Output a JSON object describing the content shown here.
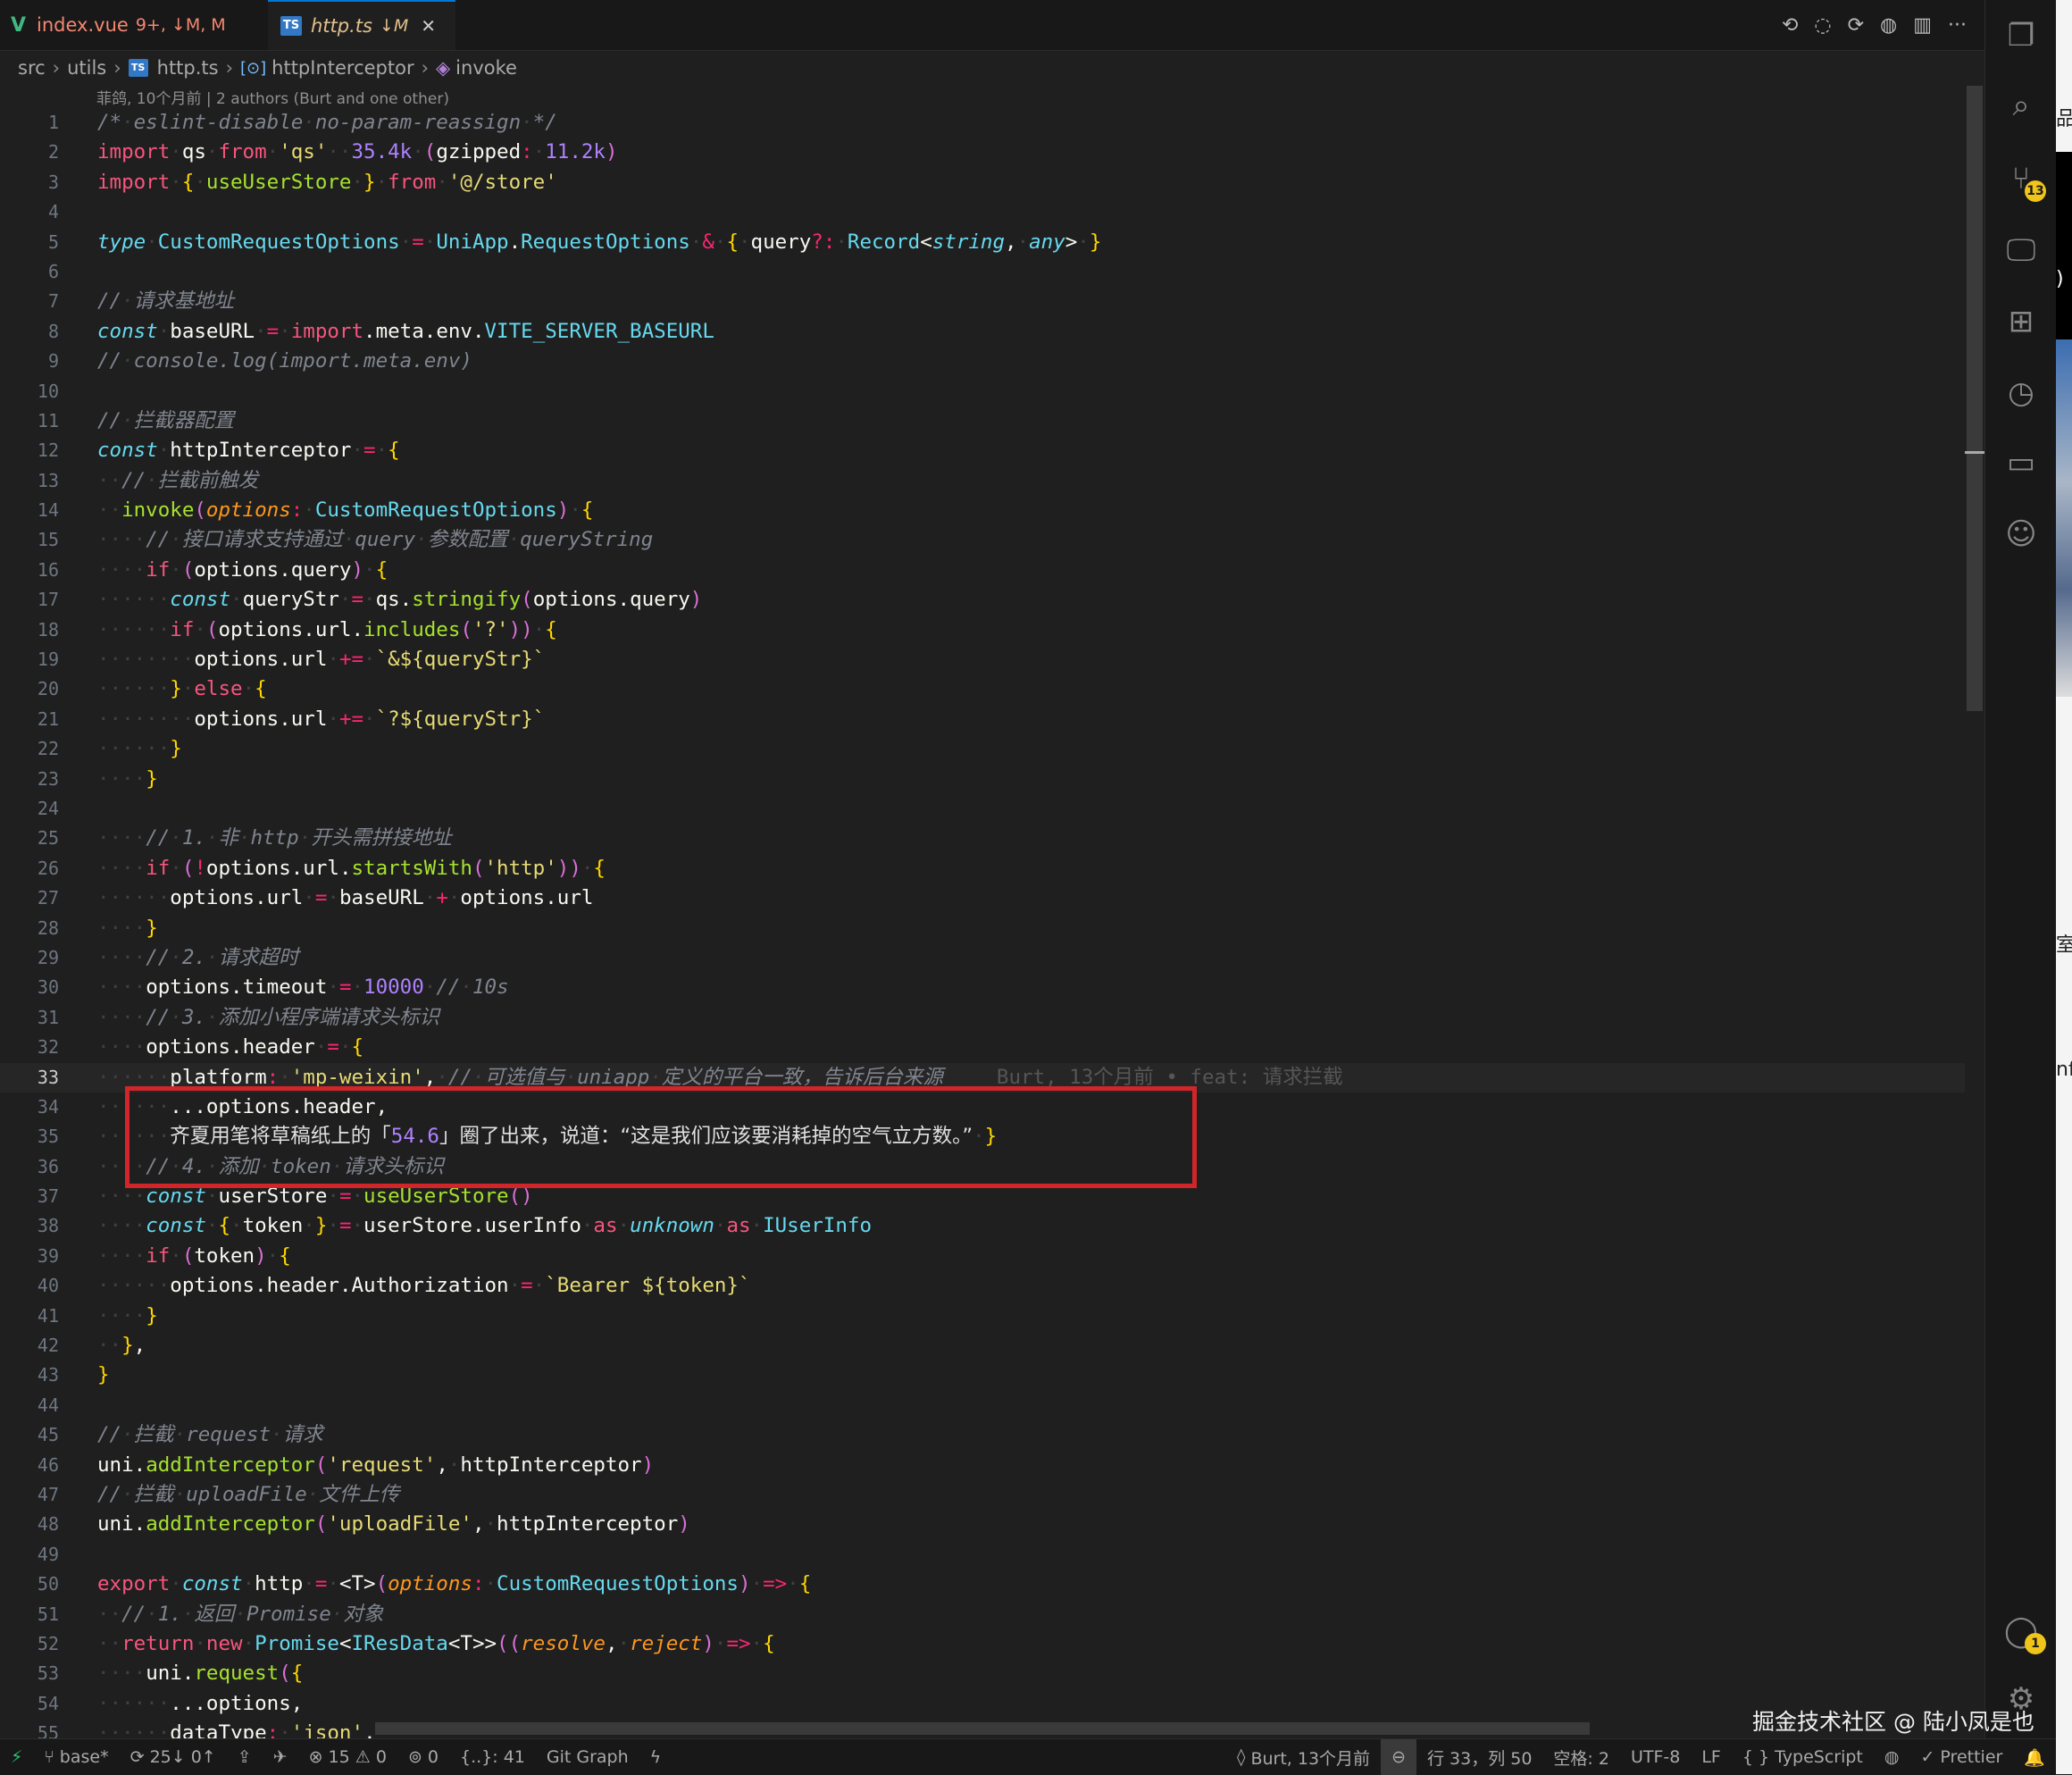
{
  "tabs": [
    {
      "name": "index.vue",
      "meta": "9+, ↓M, M",
      "active": false
    },
    {
      "name": "http.ts",
      "meta": "↓M",
      "active": true
    }
  ],
  "tab_close_glyph": "✕",
  "editor_actions": [
    "⟲",
    "◌",
    "⟳",
    "◍",
    "▥",
    "···"
  ],
  "breadcrumb": [
    "src",
    "utils",
    "http.ts",
    "httpInterceptor",
    "invoke"
  ],
  "blame_header": "菲鸽, 10个月前 | 2 authors (Burt and one other)",
  "inline_blame": "Burt, 13个月前 • feat: 请求拦截",
  "current_line": 33,
  "line_numbers": [
    "1",
    "2",
    "3",
    "4",
    "5",
    "6",
    "7",
    "8",
    "9",
    "10",
    "11",
    "12",
    "13",
    "14",
    "15",
    "16",
    "17",
    "18",
    "19",
    "20",
    "21",
    "22",
    "23",
    "24",
    "25",
    "26",
    "27",
    "28",
    "29",
    "30",
    "31",
    "32",
    "33",
    "34",
    "35",
    "36",
    "37",
    "38",
    "39",
    "40",
    "41",
    "42",
    "43",
    "44",
    "45",
    "46",
    "47",
    "48",
    "49",
    "50",
    "51",
    "52",
    "53",
    "54",
    "55"
  ],
  "code_lines": [
    "/* eslint-disable no-param-reassign */",
    "import qs from 'qs'  35.4k (gzipped: 11.2k)",
    "import { useUserStore } from '@/store'",
    "",
    "type CustomRequestOptions = UniApp.RequestOptions & { query?: Record<string, any> }",
    "",
    "// 请求基地址",
    "const baseURL = import.meta.env.VITE_SERVER_BASEURL",
    "// console.log(import.meta.env)",
    "",
    "// 拦截器配置",
    "const httpInterceptor = {",
    "  // 拦截前触发",
    "  invoke(options: CustomRequestOptions) {",
    "    // 接口请求支持通过 query 参数配置 queryString",
    "    if (options.query) {",
    "      const queryStr = qs.stringify(options.query)",
    "      if (options.url.includes('?')) {",
    "        options.url += `&${queryStr}`",
    "      } else {",
    "        options.url += `?${queryStr}`",
    "      }",
    "    }",
    "",
    "    // 1. 非 http 开头需拼接地址",
    "    if (!options.url.startsWith('http')) {",
    "      options.url = baseURL + options.url",
    "    }",
    "    // 2. 请求超时",
    "    options.timeout = 10000 // 10s",
    "    // 3. 添加小程序端请求头标识",
    "    options.header = {",
    "      platform: 'mp-weixin', // 可选值与 uniapp 定义的平台一致，告诉后台来源",
    "      ...options.header,",
    "      齐夏用笔将草稿纸上的「54.6」圈了出来，说道：“这是我们应该要消耗掉的空气立方数。” }",
    "    // 4. 添加 token 请求头标识",
    "    const userStore = useUserStore()",
    "    const { token } = userStore.userInfo as unknown as IUserInfo",
    "    if (token) {",
    "      options.header.Authorization = `Bearer ${token}`",
    "    }",
    "  },",
    "}",
    "",
    "// 拦截 request 请求",
    "uni.addInterceptor('request', httpInterceptor)",
    "// 拦截 uploadFile 文件上传",
    "uni.addInterceptor('uploadFile', httpInterceptor)",
    "",
    "export const http = <T>(options: CustomRequestOptions) => {",
    "  // 1. 返回 Promise 对象",
    "  return new Promise<IResData<T>>((resolve, reject) => {",
    "    uni.request({",
    "      ...options,",
    "      dataType: 'json',"
  ],
  "activity_badges": {
    "source_control": "13",
    "accounts": "1"
  },
  "activity_icons": [
    "files-icon",
    "search-icon",
    "source-control-icon",
    "remote-explorer-icon",
    "extensions-icon",
    "timeline-icon",
    "folder-icon",
    "copilot-icon"
  ],
  "status": {
    "branch": "base*",
    "sync": "25↓ 0↑",
    "errors": "15",
    "warnings": "0",
    "ports": "0",
    "braces": "{..}: 41",
    "git_graph": "Git Graph",
    "blame": "Burt, 13个月前",
    "position": "行 33，列 50",
    "spaces": "空格: 2",
    "encoding": "UTF-8",
    "eol": "LF",
    "language": "{ } TypeScript",
    "formatter": "✓ Prettier"
  },
  "watermark": "掘金技术社区 @ 陆小凤是也",
  "edge_fragments": [
    "品",
    ")",
    "室",
    "nf"
  ],
  "colors": {
    "editor_bg": "#1f1f1f",
    "highlight_box": "#d0262a",
    "badge": "#f0c419",
    "accent": "#0078d4"
  }
}
